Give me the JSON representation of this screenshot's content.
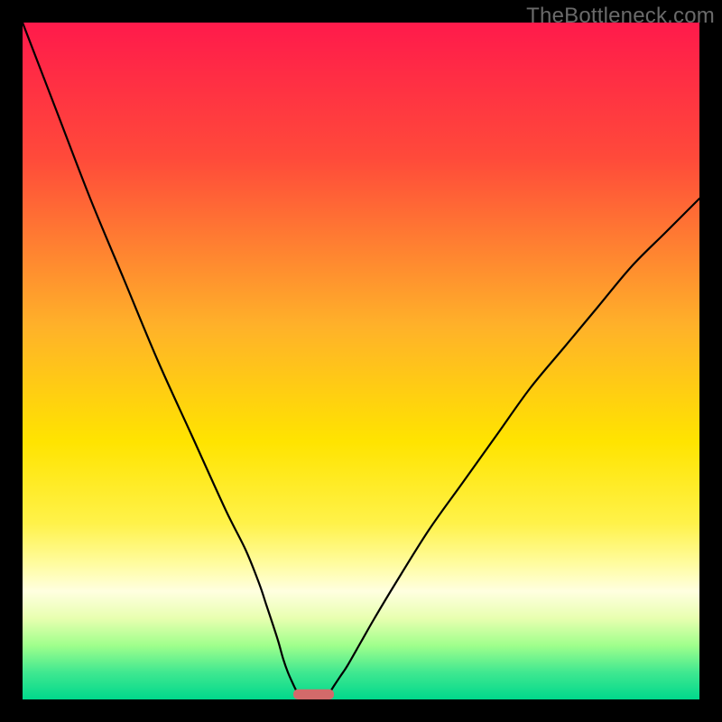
{
  "watermark": "TheBottleneck.com",
  "chart_data": {
    "type": "line",
    "title": "",
    "xlabel": "",
    "ylabel": "",
    "xlim": [
      0,
      100
    ],
    "ylim": [
      0,
      100
    ],
    "background_gradient_stops": [
      {
        "offset": 0.0,
        "color": "#ff1a4b"
      },
      {
        "offset": 0.2,
        "color": "#ff4a3a"
      },
      {
        "offset": 0.45,
        "color": "#ffb229"
      },
      {
        "offset": 0.62,
        "color": "#ffe400"
      },
      {
        "offset": 0.74,
        "color": "#fff24a"
      },
      {
        "offset": 0.8,
        "color": "#fffca0"
      },
      {
        "offset": 0.84,
        "color": "#ffffe0"
      },
      {
        "offset": 0.88,
        "color": "#e8ffb0"
      },
      {
        "offset": 0.92,
        "color": "#a0ff8c"
      },
      {
        "offset": 0.96,
        "color": "#40e890"
      },
      {
        "offset": 1.0,
        "color": "#00d88c"
      }
    ],
    "series": [
      {
        "name": "left-curve",
        "x": [
          0,
          5,
          10,
          15,
          20,
          25,
          30,
          33,
          35,
          36,
          37,
          37.8,
          38.5,
          39.2,
          40.0,
          40.5,
          41.0
        ],
        "values": [
          100,
          87,
          74,
          62,
          50,
          39,
          28,
          22,
          17,
          14,
          11,
          8.5,
          6.0,
          4.0,
          2.2,
          1.2,
          0.6
        ]
      },
      {
        "name": "right-curve",
        "x": [
          45.0,
          45.5,
          46.0,
          47.0,
          48.0,
          50,
          52,
          55,
          60,
          65,
          70,
          75,
          80,
          85,
          90,
          95,
          100
        ],
        "values": [
          0.6,
          1.2,
          2.0,
          3.5,
          5.0,
          8.5,
          12,
          17,
          25,
          32,
          39,
          46,
          52,
          58,
          64,
          69,
          74
        ]
      }
    ],
    "marker": {
      "name": "optimal-point",
      "x": 43,
      "width": 6,
      "y": 0,
      "height": 1.5,
      "color": "#d36a6a"
    }
  }
}
